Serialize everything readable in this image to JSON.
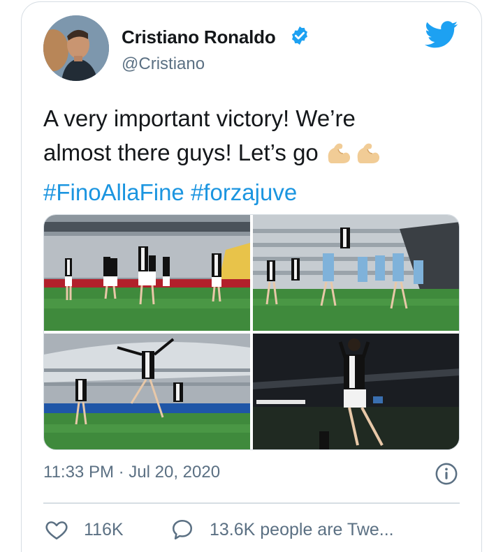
{
  "tweet": {
    "author_name": "Cristiano Ronaldo",
    "handle": "@Cristiano",
    "text_line1": "A very important victory! We’re",
    "text_line2": "almost there guys! Let’s go",
    "hashtags": "#FinoAllaFine #forzajuve",
    "timestamp": "11:33 PM · Jul 20, 2020",
    "likes": "116K",
    "people_tweeting": "13.6K people are Twe..."
  },
  "icons": {
    "verified": "verified-badge-icon",
    "brand": "twitter-bird-icon",
    "emoji": "flexed-biceps-emoji",
    "info": "info-icon",
    "like": "heart-icon",
    "reply": "speech-bubble-icon"
  },
  "colors": {
    "accent": "#1b95e0",
    "verified": "#1da1f2",
    "secondary_text": "#5b7083",
    "border": "#d6dde3"
  }
}
